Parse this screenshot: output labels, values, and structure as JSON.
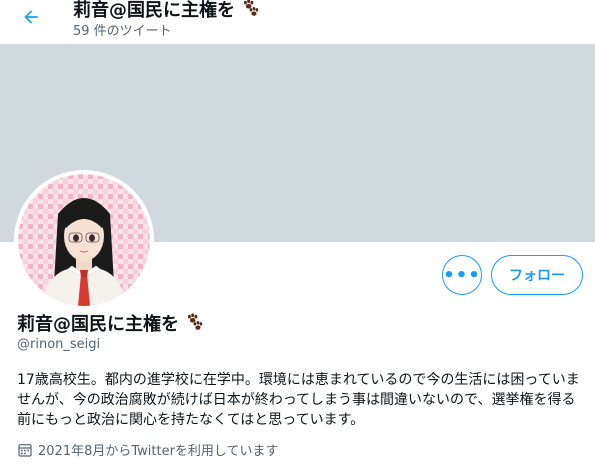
{
  "header": {
    "back_icon": "arrow-left-icon",
    "display_name": "莉音@国民に主権を",
    "name_emoji": "paw-prints-icon",
    "tweet_count": "59 件のツイート"
  },
  "profile": {
    "display_name": "莉音@国民に主権を",
    "handle": "@rinon_seigi",
    "bio": "17歳高校生。都内の進学校に在学中。環境には恵まれているので今の生活には困っていませんが、今の政治腐敗が続けば日本が終わってしまう事は間違いないので、選挙権を得る前にもっと政治に関心を持たなくてはと思っています。",
    "joined": "2021年8月からTwitterを利用しています",
    "joined_icon": "calendar-icon"
  },
  "actions": {
    "more_label": "•••",
    "more_icon": "more-options-icon",
    "follow_label": "フォロー"
  },
  "colors": {
    "accent": "#1d9bf0",
    "banner": "#cfd9de",
    "secondary_text": "#536471",
    "paw": "#5a2a1a"
  }
}
